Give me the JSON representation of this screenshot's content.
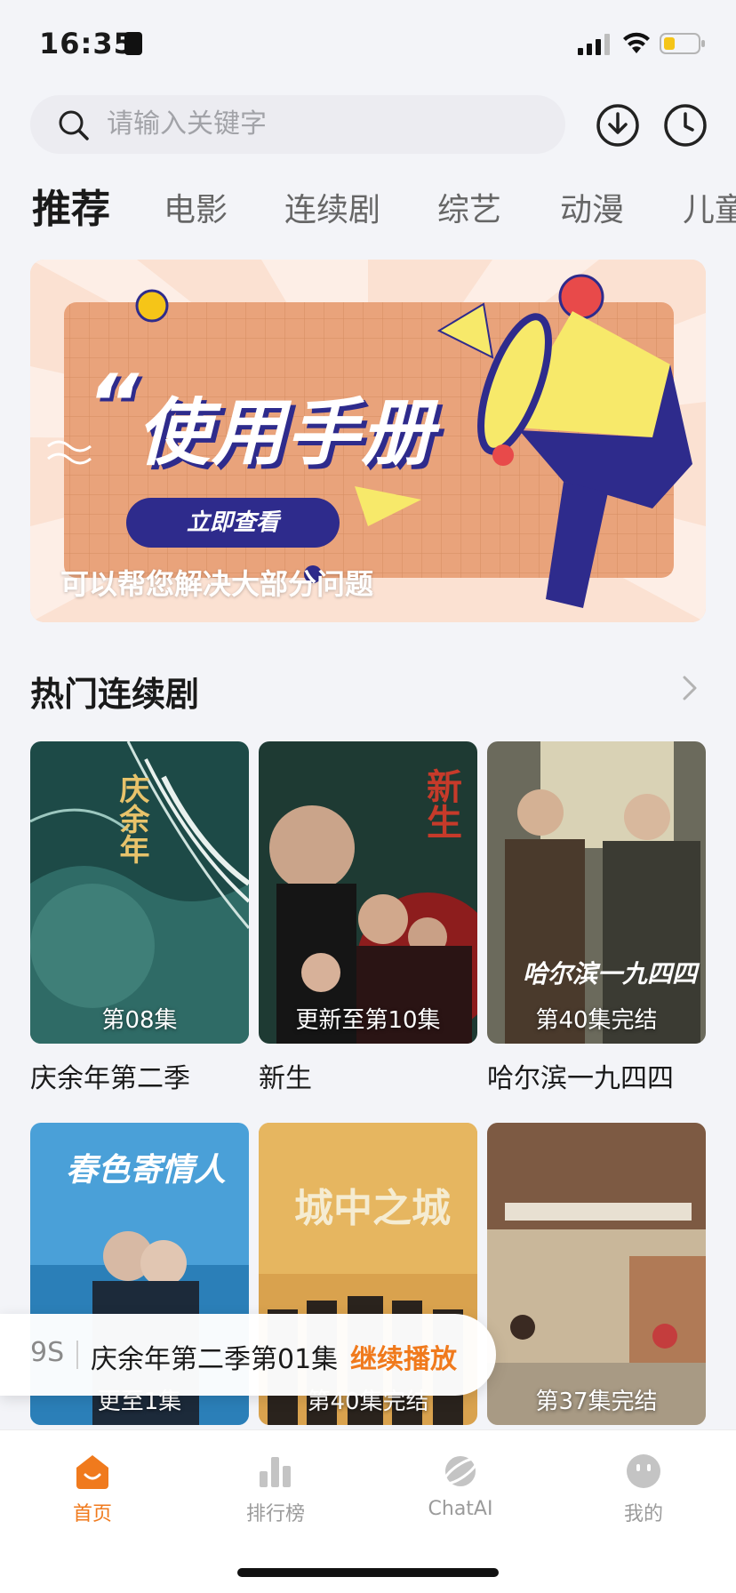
{
  "status_bar": {
    "time": "16:35"
  },
  "search": {
    "placeholder": "请输入关键字"
  },
  "tabs": [
    {
      "label": "推荐",
      "active": true
    },
    {
      "label": "电影"
    },
    {
      "label": "连续剧"
    },
    {
      "label": "综艺"
    },
    {
      "label": "动漫"
    },
    {
      "label": "儿童"
    }
  ],
  "banner": {
    "title": "使用手册",
    "quote_mark": "“",
    "button_label": "立即查看",
    "caption": "可以帮您解决大部分问题"
  },
  "section": {
    "title": "热门连续剧"
  },
  "dramas": [
    {
      "title": "庆余年第二季",
      "badge": "第08集",
      "poster_text": "庆余年"
    },
    {
      "title": "新生",
      "badge": "更新至第10集",
      "poster_text": "新生"
    },
    {
      "title": "哈尔滨一九四四",
      "badge": "第40集完结",
      "poster_text": "哈尔滨一九四四"
    },
    {
      "title": "",
      "badge": "更至1集",
      "poster_text": "春色寄情人"
    },
    {
      "title": "",
      "badge": "第40集完结",
      "poster_text": "城中之城"
    },
    {
      "title": "",
      "badge": "第37集完结",
      "poster_text": ""
    }
  ],
  "continue_toast": {
    "time": "9S",
    "episode": "庆余年第二季第01集",
    "action": "继续播放"
  },
  "bottom_nav": [
    {
      "label": "首页",
      "icon": "home-icon",
      "active": true
    },
    {
      "label": "排行榜",
      "icon": "ranking-icon"
    },
    {
      "label": "ChatAI",
      "icon": "chatai-icon"
    },
    {
      "label": "我的",
      "icon": "profile-icon"
    }
  ],
  "colors": {
    "accent": "#f07a1d",
    "banner_navy": "#2e2b8c"
  }
}
